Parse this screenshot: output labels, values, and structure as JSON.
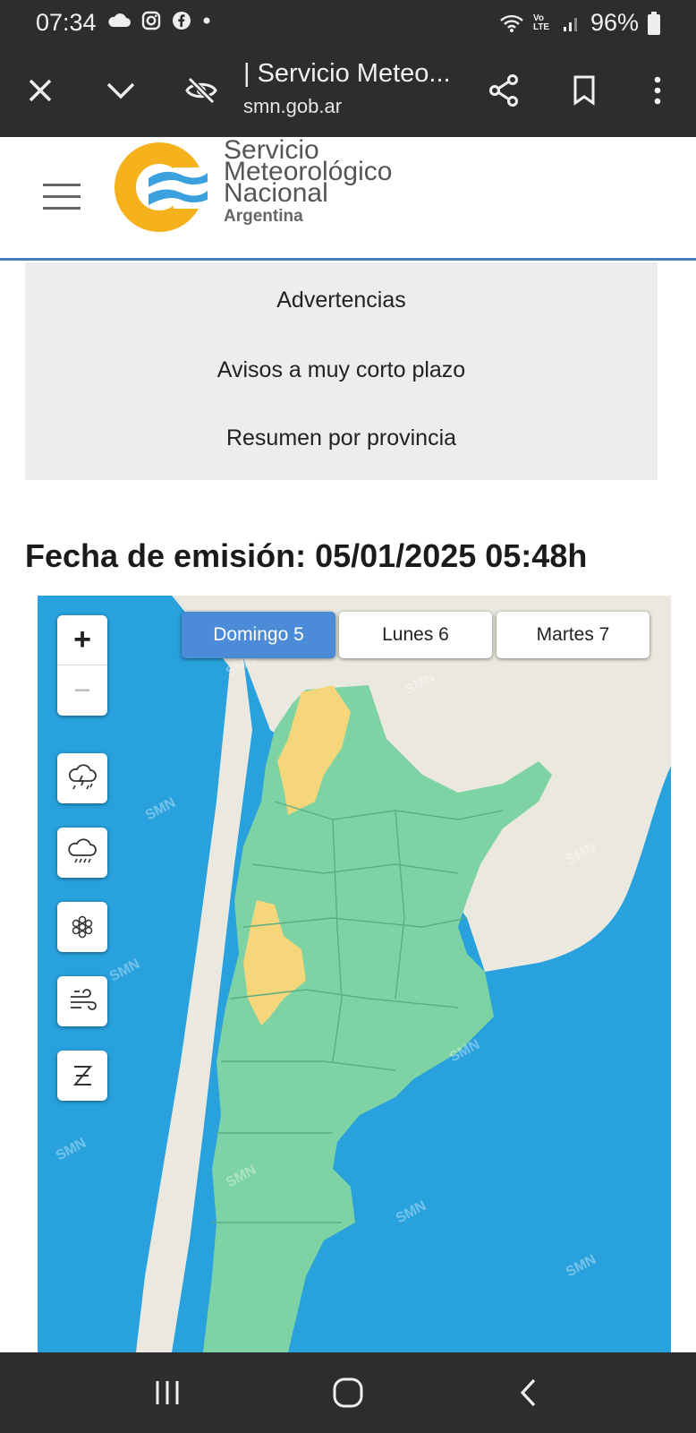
{
  "status_bar": {
    "time": "07:34",
    "battery": "96%",
    "left_icons": [
      "cloud-icon",
      "instagram-icon",
      "facebook-icon",
      "dot-icon"
    ],
    "right_icons": [
      "wifi-icon",
      "volte-icon",
      "signal-icon",
      "battery-icon"
    ],
    "volte_label": "Vo LTE"
  },
  "browser": {
    "title": "| Servicio Meteo...",
    "url": "smn.gob.ar"
  },
  "site": {
    "logo_line1": "Servicio",
    "logo_line2": "Meteorológico",
    "logo_line3": "Nacional",
    "logo_line4": "Argentina"
  },
  "menu": {
    "items": [
      "Advertencias",
      "Avisos a muy corto plazo",
      "Resumen por provincia"
    ]
  },
  "emission": {
    "text": "Fecha de emisión: 05/01/2025 05:48h"
  },
  "map": {
    "day_tabs": [
      {
        "label": "Domingo 5",
        "active": true
      },
      {
        "label": "Lunes 6",
        "active": false
      },
      {
        "label": "Martes 7",
        "active": false
      }
    ],
    "zoom_in": "+",
    "zoom_out": "−",
    "layers": [
      "storm-icon",
      "rain-icon",
      "snow-icon",
      "wind-icon",
      "zonda-icon"
    ],
    "watermark": "SMN",
    "colors": {
      "sea": "#28a1dd",
      "land": "#ebe9df",
      "green_level": "#7ed3a4",
      "yellow_level": "#f5d67a",
      "active_tab": "#4b8bd8"
    }
  },
  "system_nav": [
    "recent-apps-button",
    "home-button",
    "back-button"
  ]
}
